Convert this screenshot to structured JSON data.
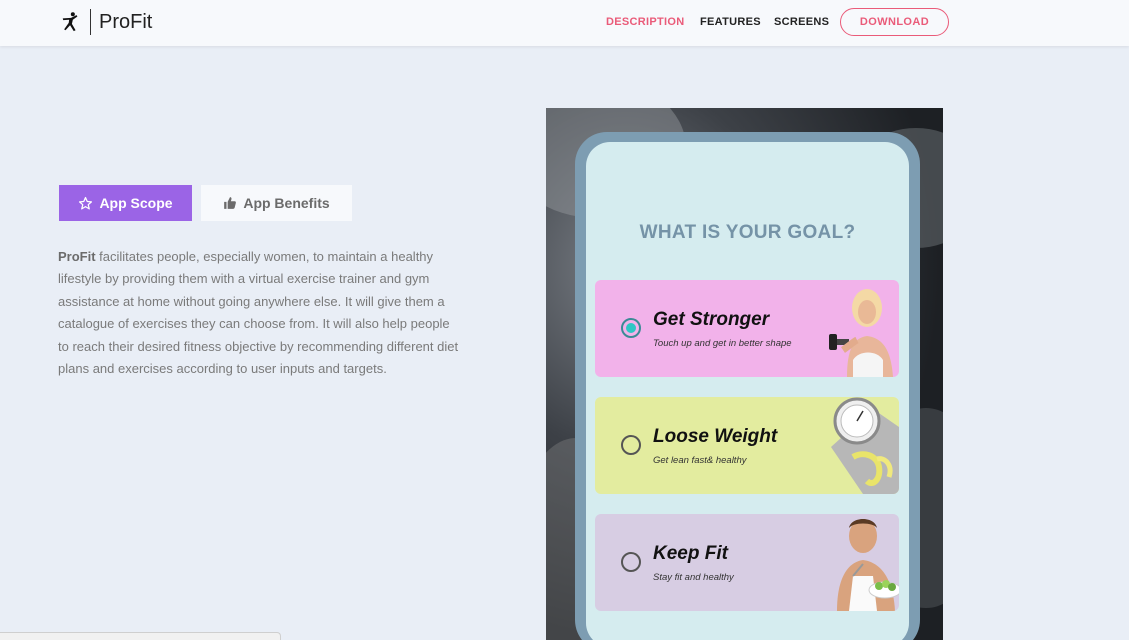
{
  "brand": {
    "name": "ProFit",
    "icon": "runner-icon"
  },
  "nav": {
    "links": [
      {
        "label": "DESCRIPTION",
        "active": true
      },
      {
        "label": "FEATURES",
        "active": false
      },
      {
        "label": "SCREENS",
        "active": false
      }
    ],
    "download_label": "DOWNLOAD"
  },
  "tabs": {
    "scope_label": "App Scope",
    "benefits_label": "App Benefits"
  },
  "description": {
    "app_name": "ProFit",
    "text": " facilitates people, especially women, to maintain a healthy lifestyle by providing them with a virtual exercise trainer and gym assistance at home without going anywhere else. It will give them a catalogue of exercises they can choose from. It will also help people to reach their desired fitness objective by recommending different diet plans and exercises according to user inputs and targets."
  },
  "phone": {
    "title": "WHAT IS YOUR GOAL?",
    "options": [
      {
        "title": "Get Stronger",
        "subtitle": "Touch up and get in better shape",
        "selected": true,
        "color": "#f2b2ea"
      },
      {
        "title": "Loose Weight",
        "subtitle": "Get lean fast& healthy",
        "selected": false,
        "color": "#e3ec9f"
      },
      {
        "title": "Keep Fit",
        "subtitle": "Stay fit and healthy",
        "selected": false,
        "color": "#d7cde3"
      }
    ]
  },
  "colors": {
    "accent": "#ea5b79",
    "purple": "#9b64e6",
    "background": "#e9eef6"
  }
}
